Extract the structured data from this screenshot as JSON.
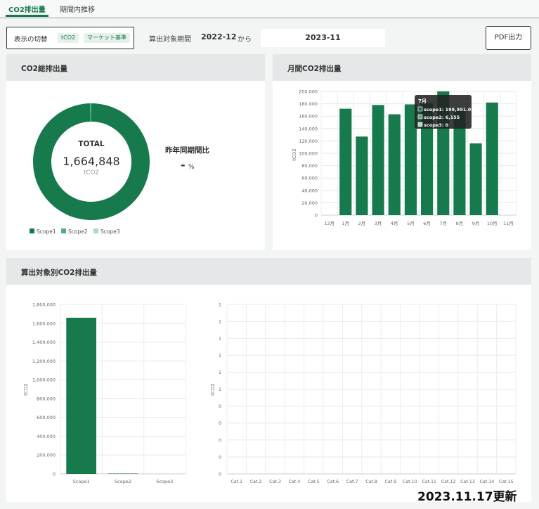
{
  "tabs": [
    {
      "label": "CO2排出量",
      "active": true
    },
    {
      "label": "期間内推移",
      "active": false
    }
  ],
  "toolbar": {
    "toggle_label": "表示の切替",
    "unit_pill": "tCO2",
    "basis_pill": "マーケット基準",
    "period_label": "算出対象期間",
    "period_from": "2022-12",
    "period_separator": "から",
    "period_to": "2023-11",
    "pdf_button": "PDF出力"
  },
  "total_card": {
    "title": "CO2総排出量",
    "total_label": "TOTAL",
    "total_value": "1,664,848",
    "total_unit": "tCO2",
    "yoy_label": "昨年同期間比",
    "yoy_value": "-",
    "yoy_unit": "%",
    "legend": [
      {
        "name": "Scope1",
        "color": "#167a4c"
      },
      {
        "name": "Scope2",
        "color": "#4eb07d"
      },
      {
        "name": "Scope3",
        "color": "#a8dcbf"
      }
    ]
  },
  "monthly_card": {
    "title": "月間CO2排出量",
    "ylabel": "tCO2",
    "tooltip": {
      "title": "7月",
      "lines": [
        "scope1: 199,991.02",
        "scope2: 6,155",
        "scope3: 0"
      ]
    }
  },
  "target_card": {
    "title": "算出対象別CO2排出量",
    "ylabel_left": "tCO2",
    "ylabel_right": "tCO2"
  },
  "footer": {
    "updated": "2023.11.17更新"
  },
  "chart_data": [
    {
      "type": "pie",
      "categories": [
        "Scope1",
        "Scope2",
        "Scope3"
      ],
      "values": [
        1658693,
        6155,
        0
      ],
      "colors": [
        "#167a4c",
        "#4eb07d",
        "#a8dcbf"
      ],
      "legend": "bottom-left"
    },
    {
      "type": "bar",
      "categories": [
        "12月",
        "1月",
        "2月",
        "3月",
        "4月",
        "5月",
        "6月",
        "7月",
        "8月",
        "9月",
        "10月",
        "11月"
      ],
      "values": [
        0,
        172000,
        127000,
        178000,
        163000,
        179000,
        181000,
        199991,
        173000,
        116000,
        182000,
        0
      ],
      "ylabel": "tCO2",
      "ylim": [
        0,
        200000
      ],
      "yticks": [
        "0",
        "20,000",
        "40,000",
        "60,000",
        "80,000",
        "100,000",
        "120,000",
        "140,000",
        "160,000",
        "180,000",
        "200,000"
      ],
      "grid": true,
      "color": "#167a4c"
    },
    {
      "type": "bar",
      "categories": [
        "Scope1",
        "Scope2",
        "Scope3"
      ],
      "values": [
        1658693,
        6155,
        0
      ],
      "ylabel": "tCO2",
      "ylim": [
        0,
        1800000
      ],
      "yticks": [
        "0",
        "200,000",
        "400,000",
        "600,000",
        "800,000",
        "1,000,000",
        "1,200,000",
        "1,400,000",
        "1,600,000",
        "1,800,000"
      ],
      "grid": true,
      "color": "#167a4c"
    },
    {
      "type": "bar",
      "categories": [
        "Cat.1",
        "Cat.2",
        "Cat.3",
        "Cat.4",
        "Cat.5",
        "Cat.6",
        "Cat.7",
        "Cat.8",
        "Cat.9",
        "Cat.10",
        "Cat.11",
        "Cat.12",
        "Cat.13",
        "Cat.14",
        "Cat.15"
      ],
      "values": [
        0,
        0,
        0,
        0,
        0,
        0,
        0,
        0,
        0,
        0,
        0,
        0,
        0,
        0,
        0
      ],
      "ylabel": "tCO2",
      "yticks": [
        "0",
        "0",
        "0",
        "0",
        "0",
        "1",
        "1",
        "1",
        "1",
        "1",
        "1"
      ],
      "grid": true,
      "color": "#167a4c"
    }
  ]
}
